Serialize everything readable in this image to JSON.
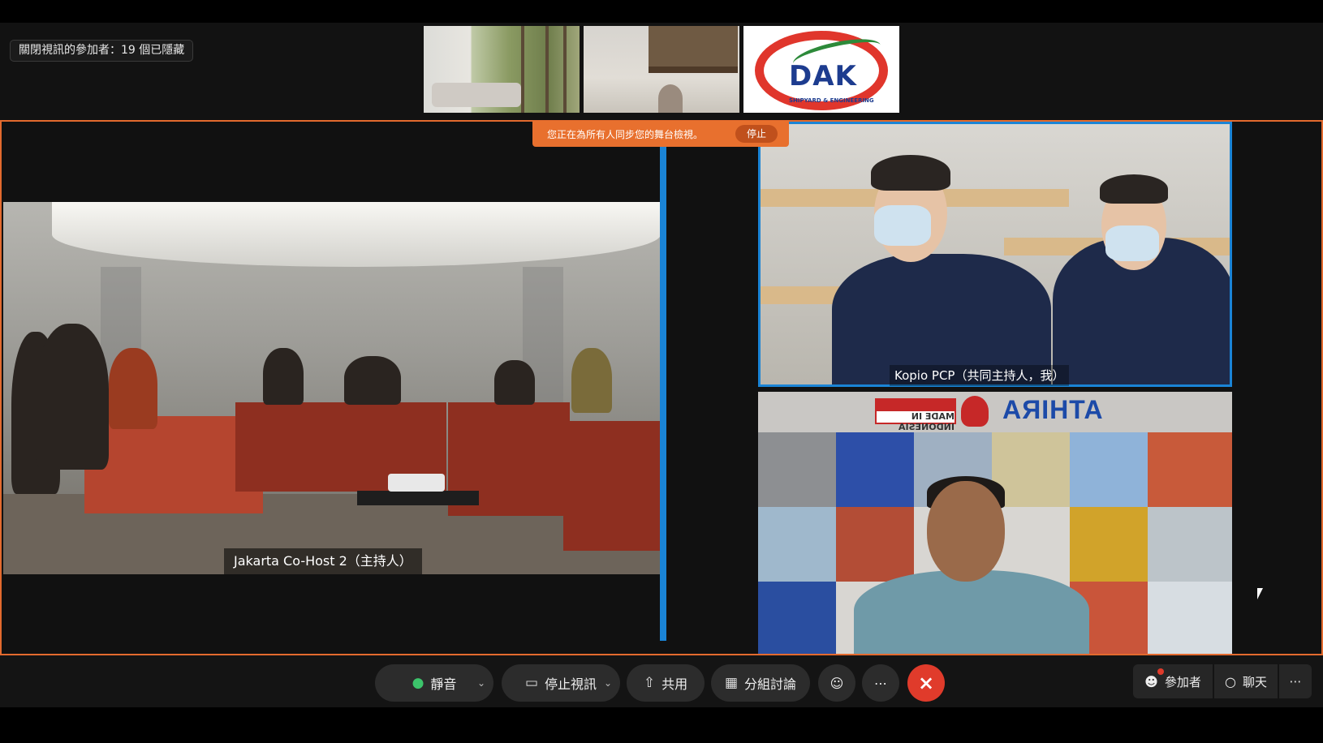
{
  "top_strip": {
    "hidden_participants_label": "關閉視訊的參加者：19 個已隱藏",
    "logo_text": "DAK",
    "logo_subtext": "SHIPYARD & ENGINEERING"
  },
  "share_banner": {
    "message": "您正在為所有人同步您的舞台檢視。",
    "stop_label": "停止"
  },
  "videos": {
    "left_name": "Jakarta Co-Host 2（主持人）",
    "right_top_name": "Kopio PCP（共同主持人，我）",
    "right_bottom_banner": {
      "made_in": "MADE IN INDONESIA",
      "brand": "ATHIRA"
    }
  },
  "toolbar": {
    "mute_label": "靜音",
    "stop_video_label": "停止視訊",
    "share_label": "共用",
    "breakout_label": "分組討論",
    "reactions_icon": "smile-icon",
    "more_icon": "ellipsis-icon",
    "leave_icon": "close-icon",
    "participants_label": "參加者",
    "chat_label": "聊天",
    "overflow_icon": "ellipsis-icon"
  },
  "colors": {
    "stage_border": "#e36a2e",
    "active_speaker": "#1a84d6",
    "leave_button": "#e03b2b"
  }
}
